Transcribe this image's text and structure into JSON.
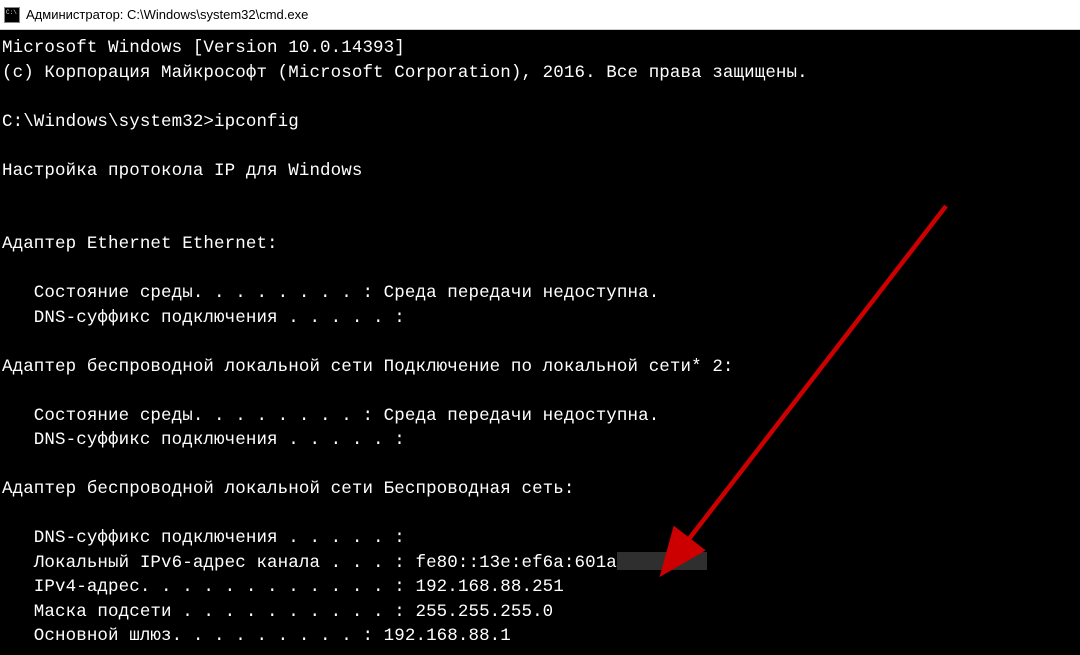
{
  "titlebar": {
    "label": "Администратор: C:\\Windows\\system32\\cmd.exe"
  },
  "terminal": {
    "lines": [
      "Microsoft Windows [Version 10.0.14393]",
      "(c) Корпорация Майкрософт (Microsoft Corporation), 2016. Все права защищены.",
      "",
      "C:\\Windows\\system32>ipconfig",
      "",
      "Настройка протокола IP для Windows",
      "",
      "",
      "Адаптер Ethernet Ethernet:",
      "",
      "   Состояние среды. . . . . . . . : Среда передачи недоступна.",
      "   DNS-суффикс подключения . . . . . :",
      "",
      "Адаптер беспроводной локальной сети Подключение по локальной сети* 2:",
      "",
      "   Состояние среды. . . . . . . . : Среда передачи недоступна.",
      "   DNS-суффикс подключения . . . . . :",
      "",
      "Адаптер беспроводной локальной сети Беспроводная сеть:",
      "",
      "   DNS-суффикс подключения . . . . . :",
      "   Локальный IPv6-адрес канала . . . : fe80::13e:ef6a:601a",
      "   IPv4-адрес. . . . . . . . . . . . : 192.168.88.251",
      "   Маска подсети . . . . . . . . . . : 255.255.255.0",
      "   Основной шлюз. . . . . . . . . : 192.168.88.1"
    ],
    "censored_line_index": 21
  },
  "annotation": {
    "arrow_color": "#cc0000"
  }
}
